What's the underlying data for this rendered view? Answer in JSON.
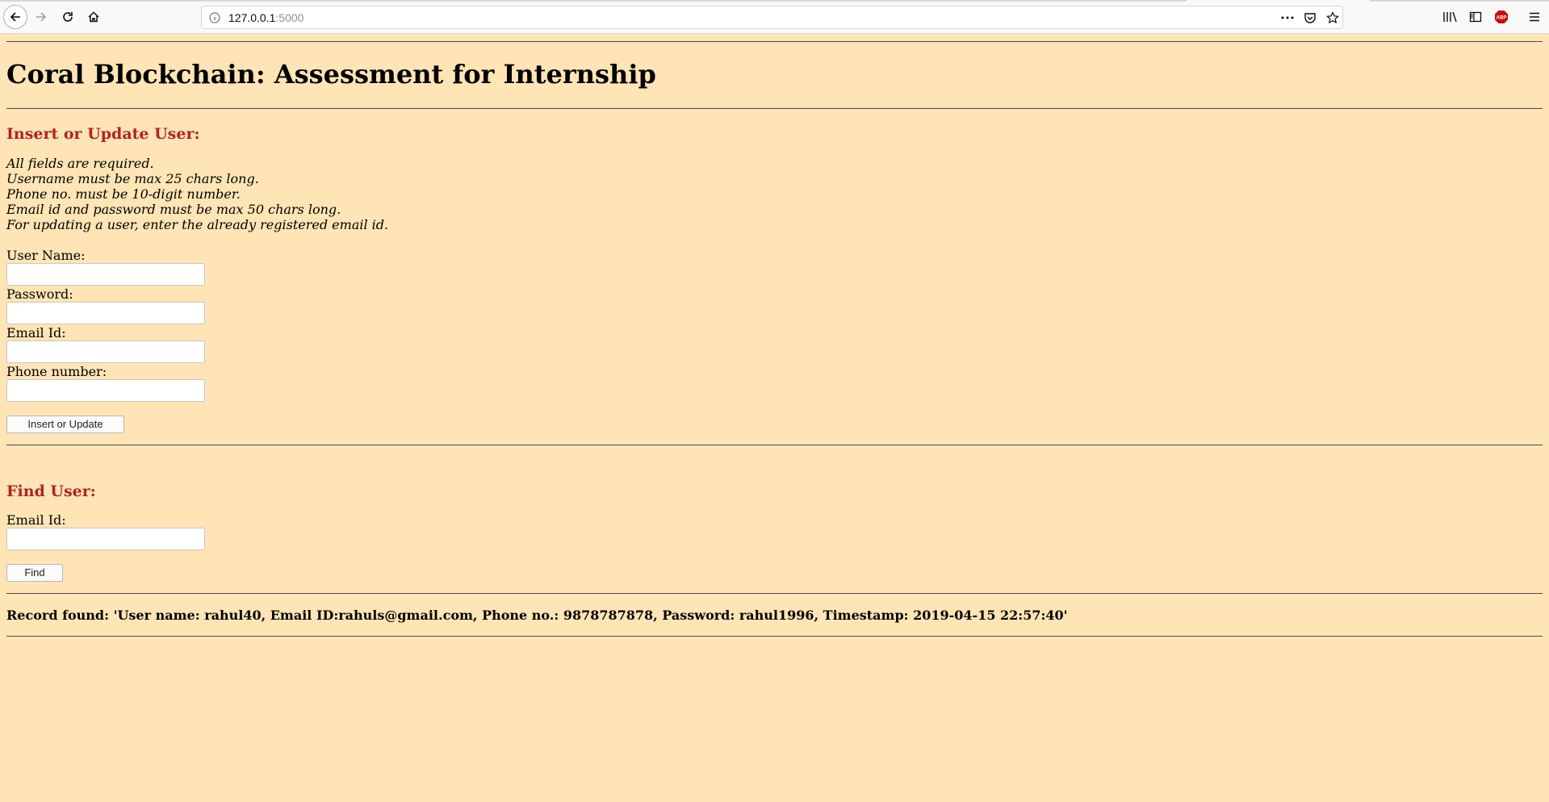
{
  "browser": {
    "url_host": "127.0.0.1",
    "url_port": ":5000"
  },
  "page": {
    "title": "Coral Blockchain: Assessment for Internship",
    "insert_section": {
      "heading": "Insert or Update User:",
      "notes": [
        "All fields are required.",
        "Username must be max 25 chars long.",
        "Phone no. must be 10-digit number.",
        "Email id and password must be max 50 chars long.",
        "For updating a user, enter the already registered email id."
      ],
      "fields": {
        "username_label": "User Name:",
        "password_label": "Password:",
        "email_label": "Email Id:",
        "phone_label": "Phone number:"
      },
      "submit_label": "Insert or Update"
    },
    "find_section": {
      "heading": "Find User:",
      "email_label": "Email Id:",
      "submit_label": "Find"
    },
    "result": "Record found: 'User name: rahul40, Email ID:rahuls@gmail.com, Phone no.: 9878787878, Password: rahul1996, Timestamp: 2019-04-15 22:57:40'"
  }
}
